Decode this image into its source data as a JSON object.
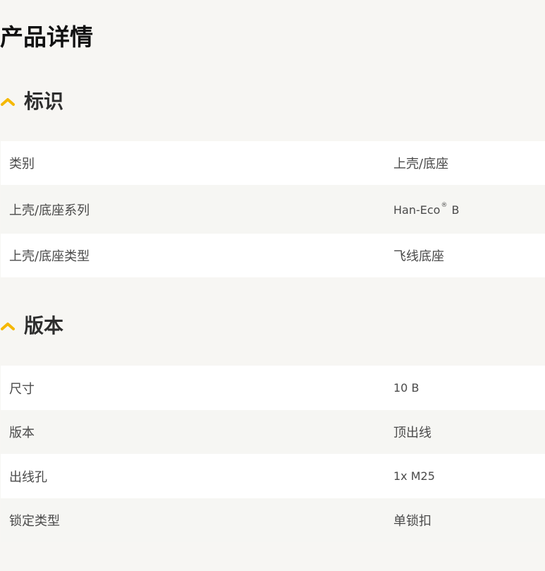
{
  "page_title": "产品详情",
  "colors": {
    "accent": "#f5b800",
    "background": "#f7f6f3",
    "row_white": "#ffffff",
    "row_grey": "#f6f6f3"
  },
  "sections": [
    {
      "title": "标识",
      "icon": "chevron-up-icon",
      "rows": [
        {
          "label": "类别",
          "value": "上壳/底座"
        },
        {
          "label": "上壳/底座系列",
          "value": "Han-Eco",
          "value_sup": "®",
          "value_suffix": " B"
        },
        {
          "label": "上壳/底座类型",
          "value": "飞线底座"
        }
      ]
    },
    {
      "title": "版本",
      "icon": "chevron-up-icon",
      "rows": [
        {
          "label": "尺寸",
          "value": "10 B"
        },
        {
          "label": "版本",
          "value": "顶出线"
        },
        {
          "label": "出线孔",
          "value": "1x M25"
        },
        {
          "label": "锁定类型",
          "value": "单锁扣"
        }
      ]
    }
  ]
}
